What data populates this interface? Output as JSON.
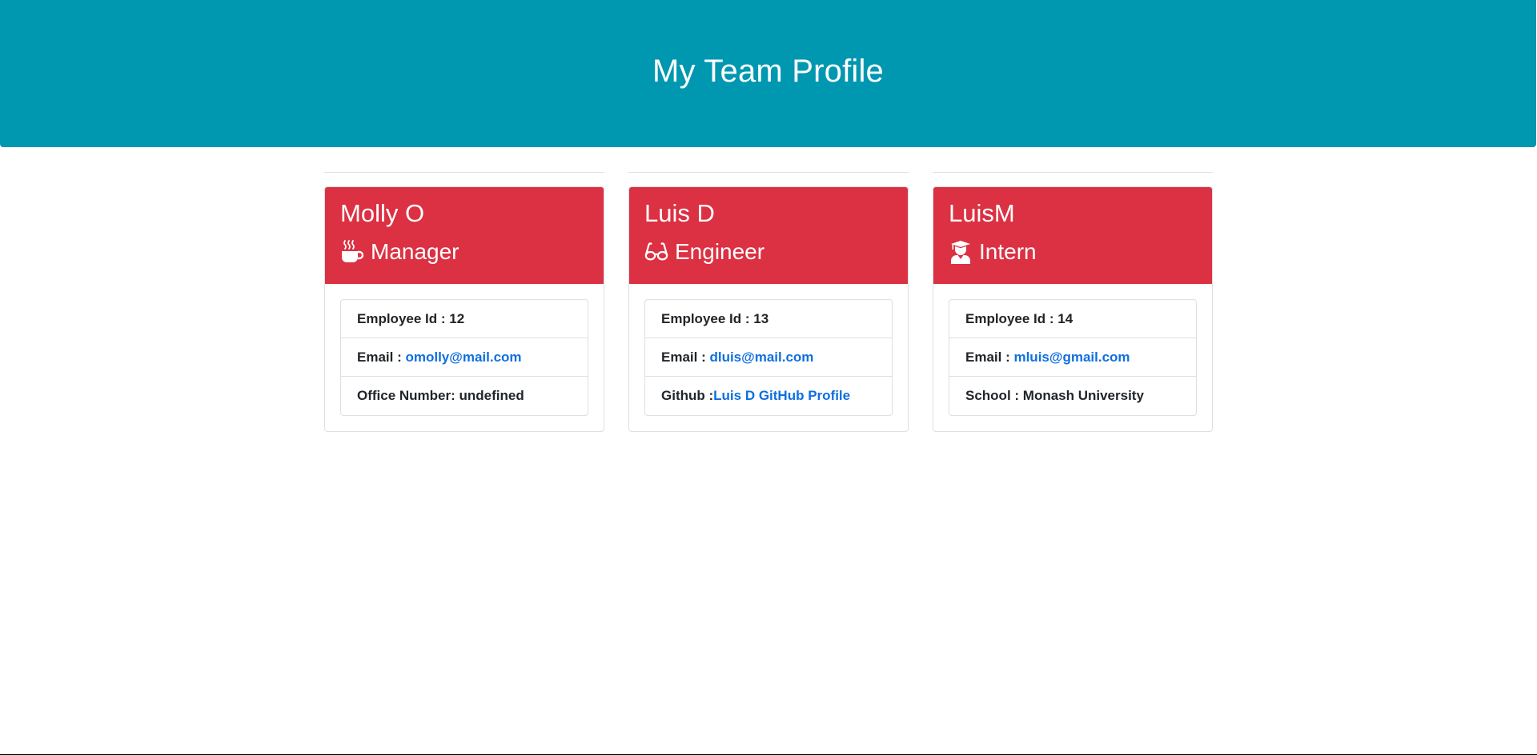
{
  "header": {
    "title": "My Team Profile"
  },
  "colors": {
    "header_bg": "#0097b0",
    "card_header_bg": "#dc3043",
    "link": "#0f6fe0"
  },
  "employees": [
    {
      "name": "Molly O",
      "role": "Manager",
      "role_icon": "mug-hot-icon",
      "id_label": "Employee Id : 12",
      "email_label": "Email : ",
      "email": "omolly@mail.com",
      "extra_label": "Office Number: undefined"
    },
    {
      "name": "Luis D",
      "role": "Engineer",
      "role_icon": "glasses-icon",
      "id_label": "Employee Id : 13",
      "email_label": "Email : ",
      "email": "dluis@mail.com",
      "extra_label": "Github :",
      "extra_link": "Luis D GitHub Profile"
    },
    {
      "name": "LuisM",
      "role": "Intern",
      "role_icon": "user-graduate-icon",
      "id_label": "Employee Id : 14",
      "email_label": "Email : ",
      "email": "mluis@gmail.com",
      "extra_label": "School : Monash University"
    }
  ]
}
